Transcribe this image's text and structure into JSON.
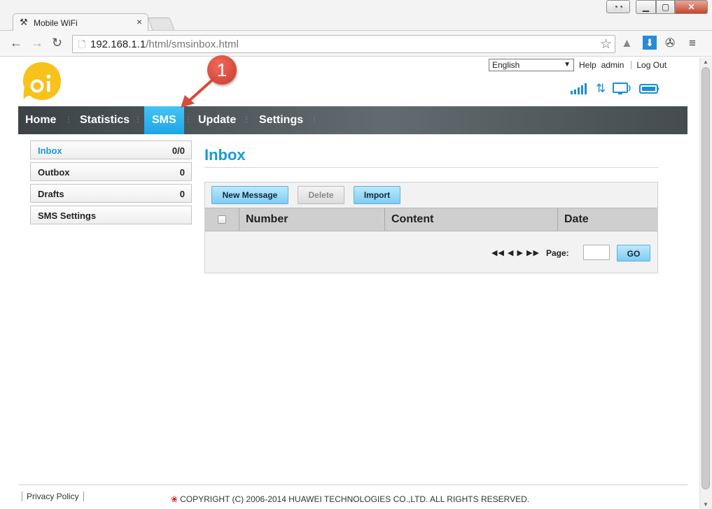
{
  "browser": {
    "tab_title": "Mobile WiFi",
    "tab_close": "×",
    "url_host": "192.168.1.1",
    "url_path": "/html/smsinbox.html"
  },
  "header": {
    "language": "English",
    "help": "Help",
    "user": "admin",
    "logout": "Log Out"
  },
  "nav": {
    "items": [
      "Home",
      "Statistics",
      "SMS",
      "Update",
      "Settings"
    ],
    "active": "SMS"
  },
  "annotation": {
    "number": "1",
    "color": "#d84a3b"
  },
  "sidebar": {
    "items": [
      {
        "label": "Inbox",
        "count": "0/0"
      },
      {
        "label": "Outbox",
        "count": "0"
      },
      {
        "label": "Drafts",
        "count": "0"
      },
      {
        "label": "SMS Settings",
        "count": ""
      }
    ]
  },
  "main": {
    "title": "Inbox",
    "buttons": {
      "new_message": "New Message",
      "delete": "Delete",
      "import": "Import"
    },
    "columns": [
      "Number",
      "Content",
      "Date"
    ],
    "pager": {
      "arrows": "◀◀ ◀ ▶ ▶▶",
      "page_label": "Page:",
      "go": "GO"
    }
  },
  "footer": {
    "privacy": "Privacy Policy",
    "copyright": "COPYRIGHT (C) 2006-2014 HUAWEI TECHNOLOGIES CO.,LTD. ALL RIGHTS RESERVED."
  },
  "colors": {
    "accent": "#1a9ad6",
    "nav_active": "#1da6e6",
    "nav_bar": "#4a5256"
  }
}
